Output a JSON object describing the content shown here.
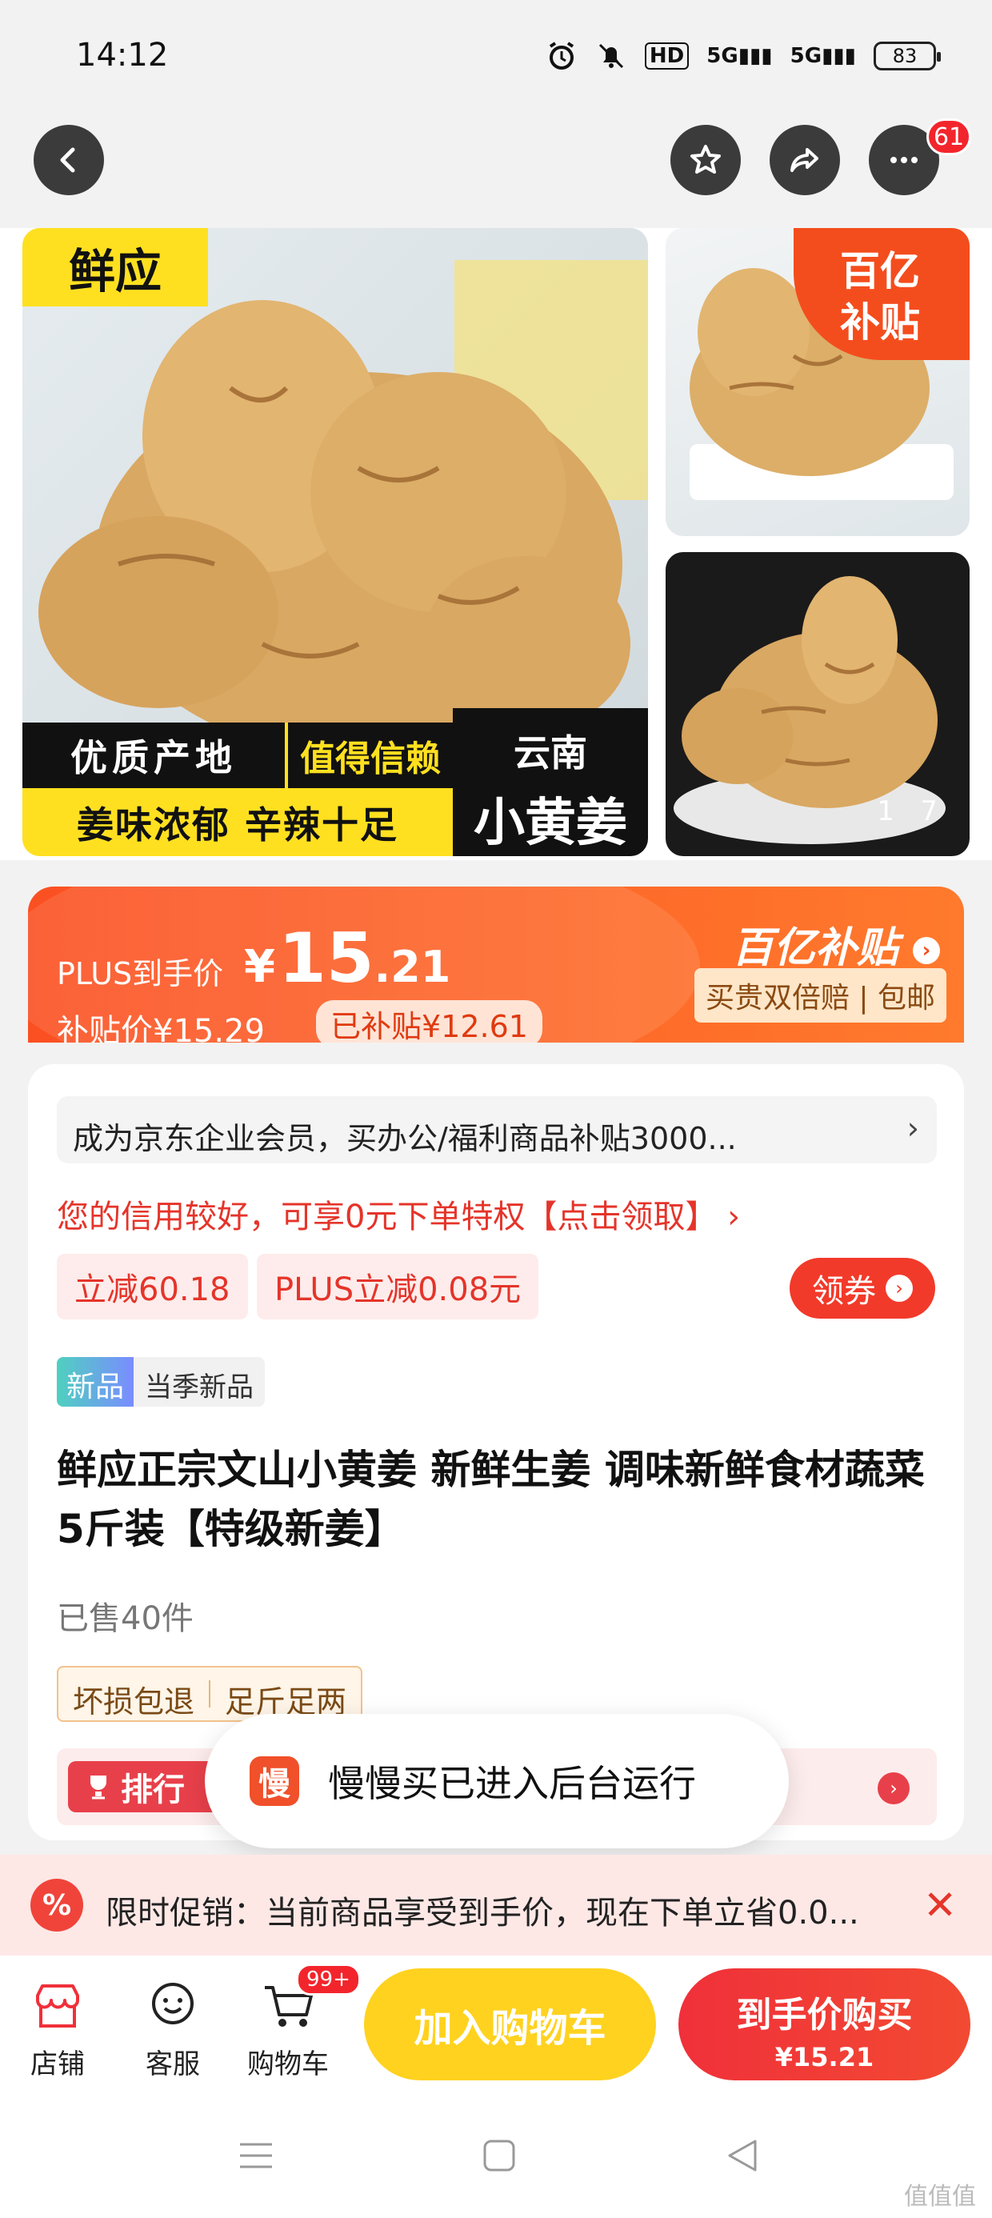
{
  "status_bar": {
    "time": "14:12",
    "network1": "5G",
    "network2": "5G",
    "hd": "HD",
    "battery": "83"
  },
  "nav": {
    "notification_count": "61"
  },
  "gallery": {
    "brand_tag": "鲜应",
    "caption_origin": "优质产地",
    "caption_trust": "值得信赖",
    "caption_flavor": "姜味浓郁 辛辣十足",
    "caption_region": "云南",
    "caption_product": "小黄姜",
    "subsidy_badge_line1": "百亿",
    "subsidy_badge_line2": "补贴",
    "counter_current": "1",
    "counter_total": "7"
  },
  "price": {
    "plus_label": "PLUS到手价",
    "yen": "¥",
    "plus_price_int": "15",
    "plus_price_dec": ".21",
    "subsidy_label": "补贴价¥15.29",
    "subsidy_chip": "已补贴¥12.61",
    "subsidy_brand": "百亿补贴",
    "guarantee": "买贵双倍赔 | 包邮"
  },
  "detail": {
    "enterprise_text": "成为京东企业会员，买办公/福利商品补贴3000...",
    "credit_text": "您的信用较好，可享0元下单特权【点击领取】",
    "discount1": "立减60.18",
    "discount2": "PLUS立减0.08元",
    "coupon_btn": "领券",
    "new_tag_a": "新品",
    "new_tag_b": "当季新品",
    "title": "鲜应正宗文山小黄姜 新鲜生姜 调味新鲜食材蔬菜 5斤装【特级新姜】",
    "sold": "已售40件",
    "service1": "坏损包退",
    "service2": "足斤足两",
    "rank_label": "排行"
  },
  "toast": {
    "app_char": "慢",
    "message": "慢慢买已进入后台运行"
  },
  "promo": {
    "icon": "%",
    "text": "限时促销：当前商品享受到手价，现在下单立省0.0..."
  },
  "bottom_bar": {
    "shop": "店铺",
    "service": "客服",
    "cart": "购物车",
    "cart_count": "99+",
    "add_to_cart": "加入购物车",
    "buy_line1": "到手价购买",
    "buy_line2": "¥15.21"
  },
  "watermark": "值值值",
  "colors": {
    "accent_red": "#f23a2a",
    "accent_orange": "#fb5022",
    "yellow": "#ffd21f"
  }
}
